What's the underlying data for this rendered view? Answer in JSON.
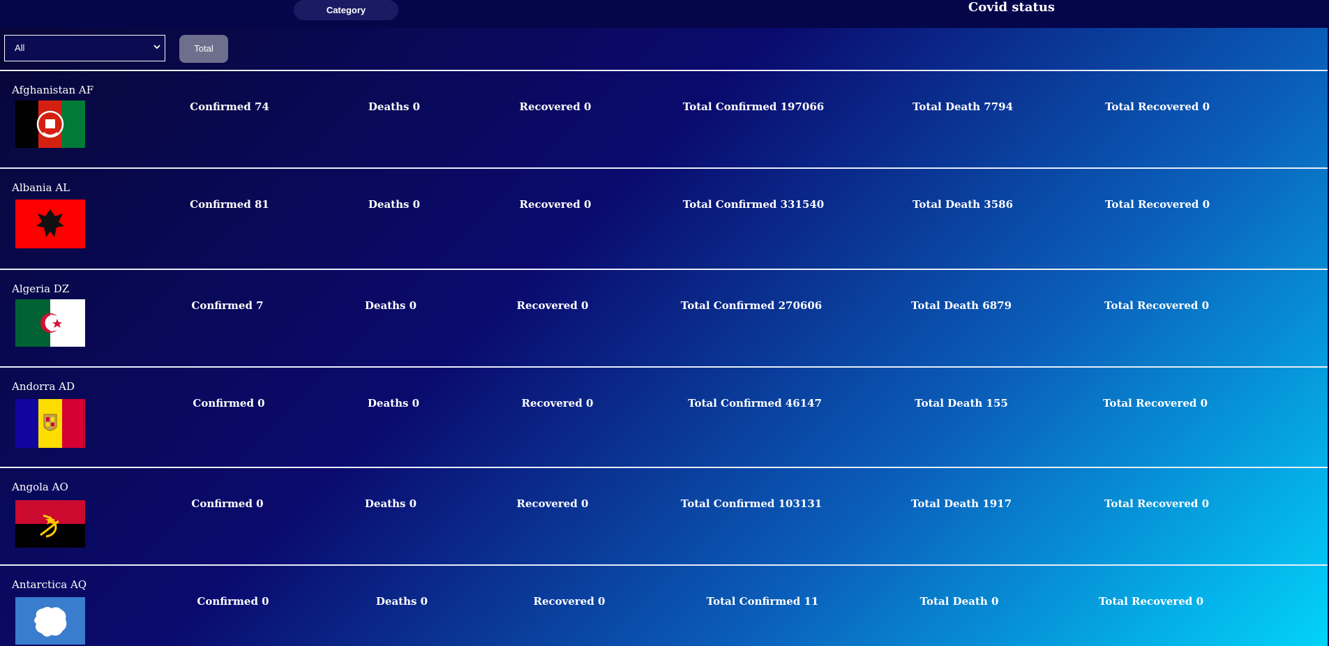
{
  "header": {
    "category_label": "Category",
    "title": "Covid status"
  },
  "controls": {
    "filter_value": "All",
    "total_label": "Total"
  },
  "rows": [
    {
      "name": "Afghanistan AF",
      "flag": "afghanistan-flag-icon",
      "confirmed": "Confirmed 74",
      "deaths": "Deaths 0",
      "recovered": "Recovered 0",
      "total_confirmed": "Total Confirmed 197066",
      "total_death": "Total Death 7794",
      "total_recovered": "Total Recovered 0"
    },
    {
      "name": "Albania AL",
      "flag": "albania-flag-icon",
      "confirmed": "Confirmed 81",
      "deaths": "Deaths 0",
      "recovered": "Recovered 0",
      "total_confirmed": "Total Confirmed 331540",
      "total_death": "Total Death 3586",
      "total_recovered": "Total Recovered 0"
    },
    {
      "name": "Algeria DZ",
      "flag": "algeria-flag-icon",
      "confirmed": "Confirmed 7",
      "deaths": "Deaths 0",
      "recovered": "Recovered 0",
      "total_confirmed": "Total Confirmed 270606",
      "total_death": "Total Death 6879",
      "total_recovered": "Total Recovered 0"
    },
    {
      "name": "Andorra AD",
      "flag": "andorra-flag-icon",
      "confirmed": "Confirmed 0",
      "deaths": "Deaths 0",
      "recovered": "Recovered 0",
      "total_confirmed": "Total Confirmed 46147",
      "total_death": "Total Death 155",
      "total_recovered": "Total Recovered 0"
    },
    {
      "name": "Angola AO",
      "flag": "angola-flag-icon",
      "confirmed": "Confirmed 0",
      "deaths": "Deaths 0",
      "recovered": "Recovered 0",
      "total_confirmed": "Total Confirmed 103131",
      "total_death": "Total Death 1917",
      "total_recovered": "Total Recovered 0"
    },
    {
      "name": "Antarctica AQ",
      "flag": "antarctica-flag-icon",
      "confirmed": "Confirmed 0",
      "deaths": "Deaths 0",
      "recovered": "Recovered 0",
      "total_confirmed": "Total Confirmed 11",
      "total_death": "Total Death 0",
      "total_recovered": "Total Recovered 0"
    }
  ]
}
